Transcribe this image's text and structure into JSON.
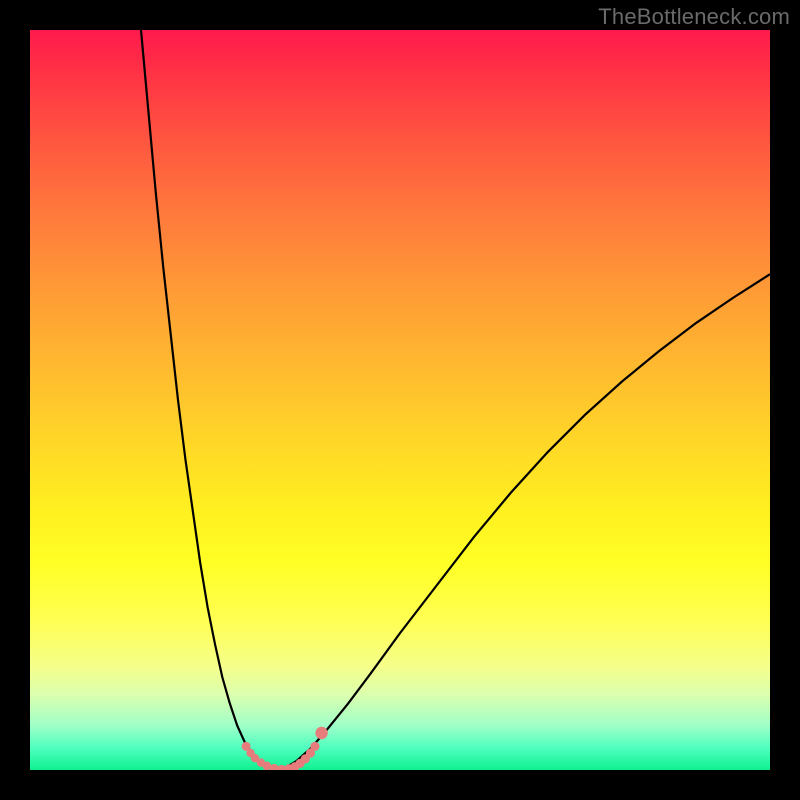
{
  "watermark": "TheBottleneck.com",
  "chart_data": {
    "type": "line",
    "title": "",
    "xlabel": "",
    "ylabel": "",
    "xlim": [
      0,
      100
    ],
    "ylim": [
      0,
      100
    ],
    "series": [
      {
        "name": "left-curve",
        "x": [
          15,
          16,
          17,
          18,
          19,
          20,
          21,
          22,
          23,
          24,
          25,
          26,
          27,
          28,
          29,
          30,
          31,
          32,
          33,
          34
        ],
        "values": [
          100,
          89,
          78,
          68,
          59,
          50,
          42,
          35,
          28,
          22,
          17,
          12.5,
          9,
          6,
          3.8,
          2.2,
          1.2,
          0.6,
          0.2,
          0
        ]
      },
      {
        "name": "right-curve",
        "x": [
          34,
          36,
          38,
          40,
          43,
          46,
          50,
          55,
          60,
          65,
          70,
          75,
          80,
          85,
          90,
          95,
          100
        ],
        "values": [
          0,
          1.2,
          3,
          5.3,
          9,
          13,
          18.5,
          25,
          31.5,
          37.5,
          43,
          48,
          52.5,
          56.6,
          60.4,
          63.8,
          67
        ]
      }
    ],
    "markers": {
      "name": "highlight-points",
      "color": "#e77c7c",
      "x": [
        29.2,
        29.8,
        30.4,
        31.2,
        32.0,
        33.0,
        34.0,
        35.0,
        35.8,
        36.5,
        37.2,
        37.9,
        38.5,
        39.4
      ],
      "values": [
        3.2,
        2.3,
        1.6,
        1.0,
        0.55,
        0.2,
        0.05,
        0.15,
        0.45,
        0.9,
        1.5,
        2.3,
        3.2,
        5.0
      ],
      "r": [
        4.5,
        4.2,
        4.2,
        4.2,
        4.4,
        4.6,
        4.8,
        4.8,
        4.6,
        4.6,
        4.6,
        4.6,
        4.6,
        6.2
      ]
    },
    "background_gradient": {
      "top_color": "#ff1a4d",
      "bottom_color": "#10f090"
    }
  }
}
